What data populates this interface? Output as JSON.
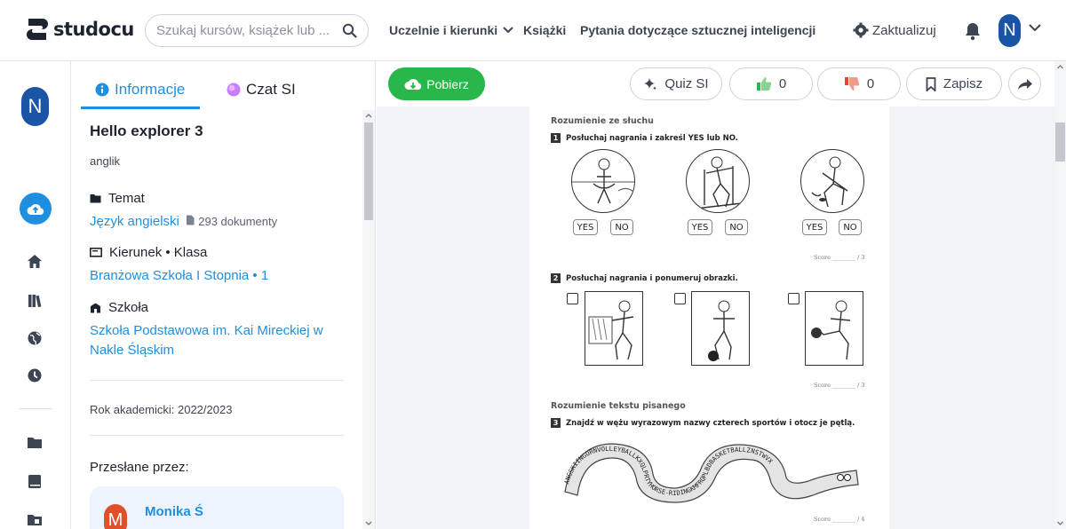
{
  "header": {
    "logo_text": "studocu",
    "search_placeholder": "Szukaj kursów, książek lub ...",
    "nav": [
      "Uczelnie i kierunki",
      "Książki",
      "Pytania dotyczące sztucznej inteligencji"
    ],
    "upgrade": "Zaktualizuj",
    "user_initial": "N"
  },
  "rail": {
    "avatar_initial": "N",
    "icons": [
      "upload-icon",
      "home-icon",
      "library-icon",
      "globe-icon",
      "clock-icon",
      "folder-icon",
      "book-icon",
      "shared-folder-icon"
    ]
  },
  "panel": {
    "tabs": {
      "info": "Informacje",
      "chat": "Czat SI"
    },
    "title": "Hello explorer 3",
    "subtitle": "anglik",
    "topic_label": "Temat",
    "topic_value": "Język angielski",
    "topic_docs": "293 dokumenty",
    "course_label": "Kierunek • Klasa",
    "course_value": "Branżowa Szkoła I Stopnia • 1",
    "school_label": "Szkoła",
    "school_value_1": "Szkoła Podstawowa im. Kai Mireckiej w",
    "school_value_2": "Nakle Śląskim",
    "year": "Rok akademicki: 2022/2023",
    "uploaded_by": "Przesłane przez:",
    "uploader_initial": "M",
    "uploader_name": "Monika Ś"
  },
  "toolbar": {
    "download": "Pobierz",
    "quiz": "Quiz SI",
    "likes": "0",
    "dislikes": "0",
    "save": "Zapisz"
  },
  "worksheet": {
    "section1": "Rozumienie ze słuchu",
    "q1_num": "1",
    "q1": "Posłuchaj nagrania i zakreśl YES lub NO.",
    "yes": "YES",
    "no": "NO",
    "score1": "Score ________ / 3",
    "q2_num": "2",
    "q2": "Posłuchaj nagrania i ponumeruj obrazki.",
    "score2": "Score ________ / 3",
    "section2": "Rozumienie tekstu pisanego",
    "q3_num": "3",
    "q3": "Znajdź w wężu wyrazowym nazwy czterech sportów i otocz je pętlą.",
    "snake_top": "ANGSKIINGORNVOLLEYBALLKXQLPRTYHORSE-RIDINGKMFRQPLBDBASKETBALLZNSTWVX",
    "score3": "Score ________ / 4",
    "colors": {
      "accent": "#1e8fe0",
      "download": "#28b74a",
      "brand": "#1a55a5"
    }
  }
}
